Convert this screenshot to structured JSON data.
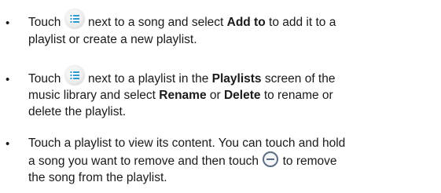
{
  "bullets": [
    {
      "lines": [
        {
          "parts": [
            {
              "t": "Touch "
            },
            {
              "icon": "menu-list-icon"
            },
            {
              "t": " next to a song and select "
            },
            {
              "t": "Add to",
              "b": true
            },
            {
              "t": " to add it to a"
            }
          ]
        },
        {
          "parts": [
            {
              "t": "playlist or create a new playlist."
            }
          ]
        }
      ]
    },
    {
      "lines": [
        {
          "parts": [
            {
              "t": "Touch "
            },
            {
              "icon": "menu-list-icon"
            },
            {
              "t": " next to a playlist in the "
            },
            {
              "t": "Playlists",
              "b": true
            },
            {
              "t": " screen of the"
            }
          ]
        },
        {
          "parts": [
            {
              "t": "music library and select "
            },
            {
              "t": "Rename",
              "b": true
            },
            {
              "t": " or "
            },
            {
              "t": "Delete",
              "b": true
            },
            {
              "t": " to rename or"
            }
          ]
        },
        {
          "parts": [
            {
              "t": "delete the playlist."
            }
          ]
        }
      ]
    },
    {
      "lines": [
        {
          "parts": [
            {
              "t": "Touch a playlist to view its content. You can touch and hold"
            }
          ]
        },
        {
          "parts": [
            {
              "t": "a song you want to remove and then touch "
            },
            {
              "icon": "remove-circle-icon"
            },
            {
              "t": " to remove"
            }
          ]
        },
        {
          "parts": [
            {
              "t": "the song from the playlist."
            }
          ]
        }
      ]
    }
  ],
  "bullet_char": "•",
  "colors": {
    "text": "#1a1a1a",
    "icon_bg": "#e6e6e6",
    "menu_glyph": "#2f9ad0",
    "remove_glyph": "#5f6f83"
  }
}
